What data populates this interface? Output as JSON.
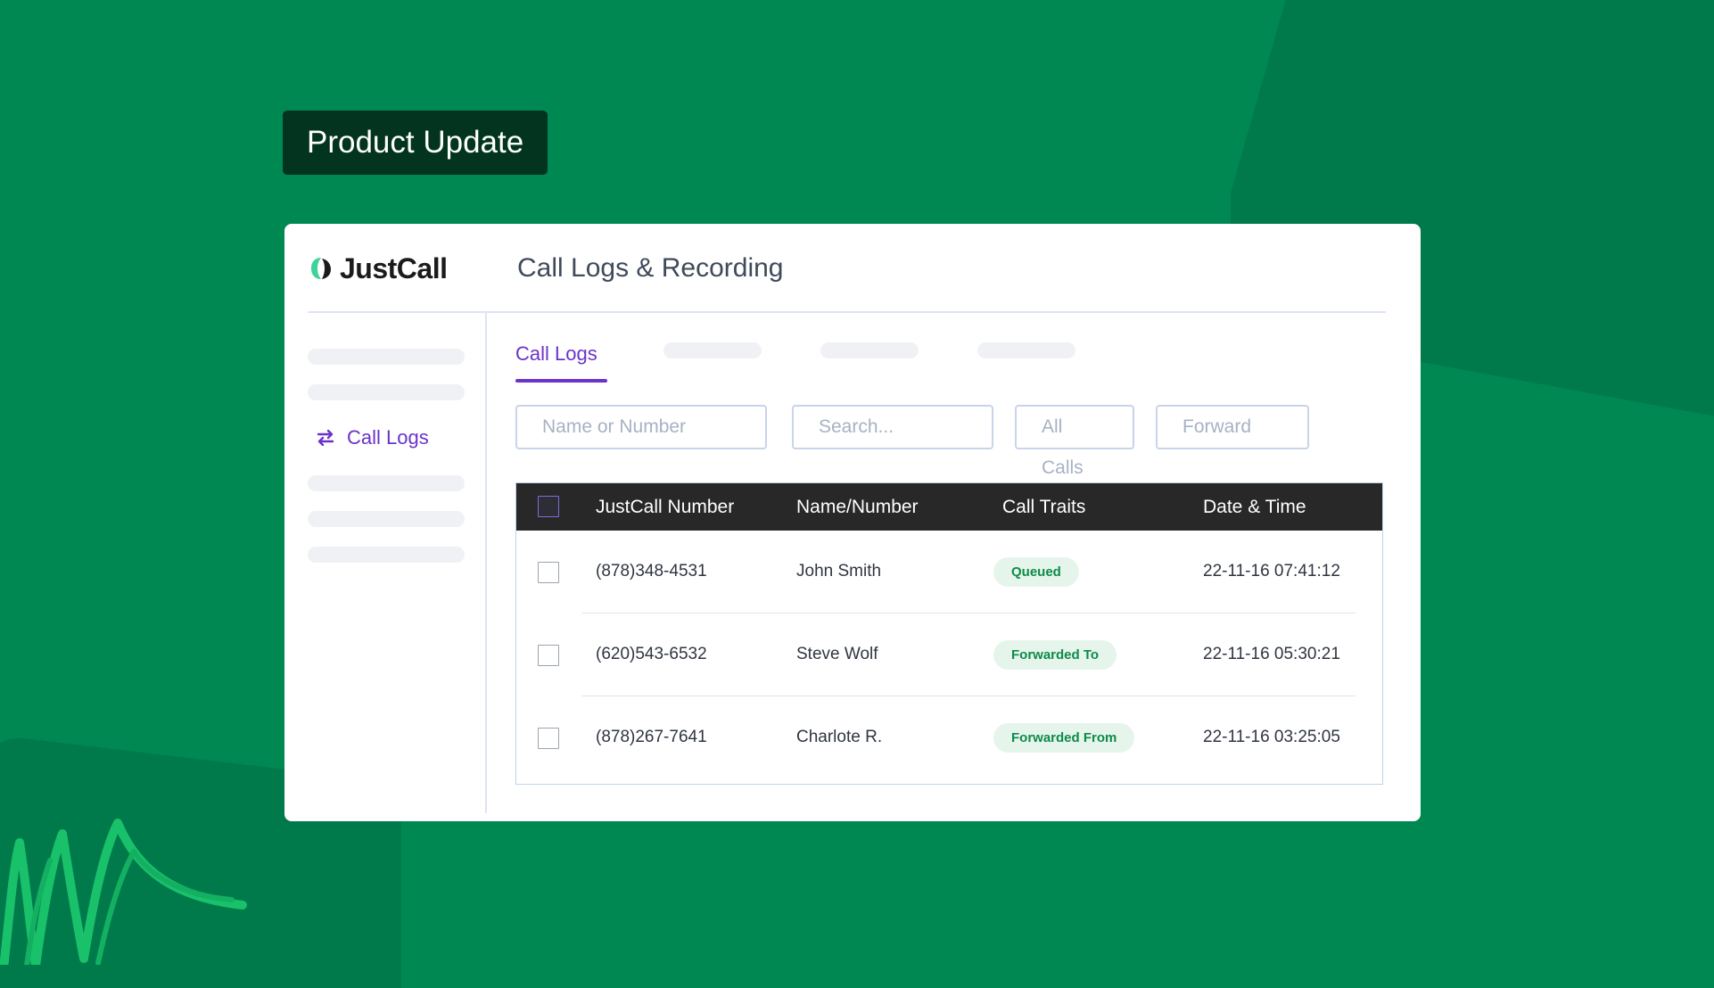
{
  "badge": {
    "label": "Product Update"
  },
  "brand": {
    "name": "JustCall",
    "accent": "#6b33c9",
    "background": "#008853"
  },
  "header": {
    "title": "Call Logs & Recording"
  },
  "sidebar": {
    "active_item": {
      "label": "Call Logs",
      "icon": "arrows-swap-icon"
    }
  },
  "tabs": {
    "active": "Call Logs"
  },
  "filters": {
    "name_placeholder": "Name or Number",
    "search_placeholder": "Search...",
    "call_type": "All Calls",
    "direction": "Forward"
  },
  "table": {
    "columns": [
      "JustCall Number",
      "Name/Number",
      "Call Traits",
      "Date & Time"
    ],
    "rows": [
      {
        "number": "(878)348-4531",
        "name": "John Smith",
        "trait": "Queued",
        "datetime": "22-11-16  07:41:12"
      },
      {
        "number": "(620)543-6532",
        "name": "Steve Wolf",
        "trait": "Forwarded To",
        "datetime": "22-11-16  05:30:21"
      },
      {
        "number": "(878)267-7641",
        "name": "Charlote R.",
        "trait": "Forwarded From",
        "datetime": "22-11-16  03:25:05"
      }
    ]
  }
}
